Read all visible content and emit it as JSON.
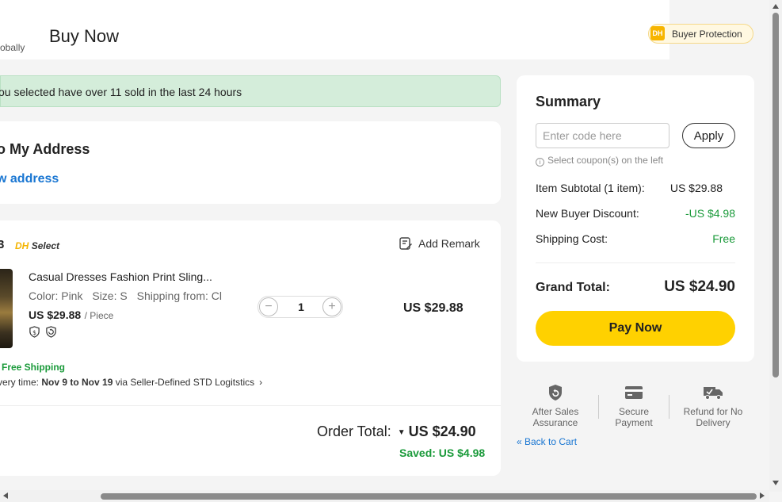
{
  "header": {
    "logo_text": "obally",
    "title": "Buy Now",
    "badge_icon": "DH",
    "badge_label": "Buyer Protection"
  },
  "banner": {
    "text": "ou selected have over 11 sold in the last 24 hours"
  },
  "address": {
    "title": "o My Address",
    "link": "w address"
  },
  "order": {
    "store_fragment": "3",
    "store_tag_dh": "DH",
    "store_tag_select": "Select",
    "add_remark": "Add Remark",
    "item": {
      "name": "Casual Dresses Fashion Print Sling...",
      "color": "Color: Pink",
      "size": "Size: S",
      "shipping_from": "Shipping from: Cl",
      "unit_price": "US $29.88",
      "unit": "/ Piece",
      "quantity": "1",
      "qty_minus": "−",
      "qty_plus": "+",
      "line_total": "US $29.88"
    },
    "free_shipping": "Free Shipping",
    "delivery_prefix": "very time: ",
    "delivery_dates": "Nov 9 to Nov 19",
    "delivery_suffix": " via Seller-Defined STD Logitstics",
    "delivery_chevron": "›",
    "total_label": "Order Total:",
    "total_caret": "▼",
    "total_value": "US $24.90",
    "saved": "Saved: US $4.98"
  },
  "summary": {
    "title": "Summary",
    "coupon_placeholder": "Enter code here",
    "apply": "Apply",
    "coupon_hint": "Select coupon(s) on the left",
    "subtotal_label": "Item Subtotal (1 item):",
    "subtotal_value": "US $29.88",
    "discount_label": "New Buyer Discount:",
    "discount_value": "-US $4.98",
    "shipping_label": "Shipping Cost:",
    "shipping_value": "Free",
    "grand_label": "Grand Total:",
    "grand_value": "US $24.90",
    "pay_now": "Pay Now"
  },
  "guarantees": [
    {
      "icon": "shield-return-icon",
      "line1": "After Sales",
      "line2": "Assurance"
    },
    {
      "icon": "credit-card-icon",
      "line1": "Secure",
      "line2": "Payment"
    },
    {
      "icon": "truck-refund-icon",
      "line1": "Refund for No",
      "line2": "Delivery"
    }
  ],
  "back_to_cart": "« Back to Cart",
  "colors": {
    "accent_yellow": "#ffd100",
    "green": "#1a9a3a",
    "link_blue": "#1976d2",
    "banner_green": "#d4edda"
  }
}
